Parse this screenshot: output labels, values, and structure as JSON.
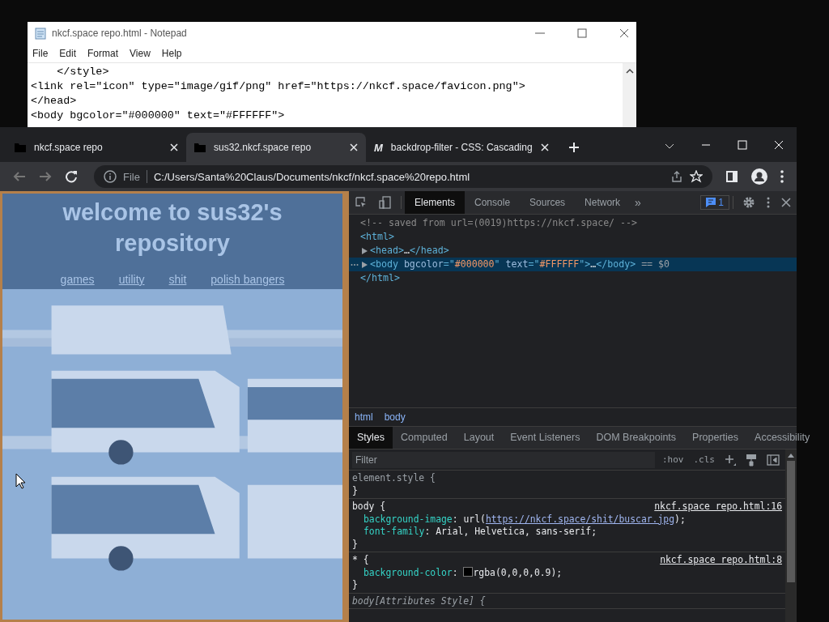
{
  "notepad": {
    "title": "nkcf.space repo.html - Notepad",
    "menu": [
      "File",
      "Edit",
      "Format",
      "View",
      "Help"
    ],
    "lines": [
      "    </style>",
      "<link rel=\"icon\" type=\"image/gif/png\" href=\"https://nkcf.space/favicon.png\">",
      "</head>",
      "<body bgcolor=\"#000000\" text=\"#FFFFFF\">"
    ]
  },
  "browser": {
    "tabs": [
      {
        "title": "nkcf.space repo",
        "selected": false,
        "kind": "page"
      },
      {
        "title": "sus32.nkcf.space repo",
        "selected": true,
        "kind": "page"
      },
      {
        "title": "backdrop-filter - CSS: Cascading",
        "selected": false,
        "kind": "logo",
        "icon_text": "M"
      }
    ],
    "address": {
      "scheme": "File",
      "url": "C:/Users/Santa%20Claus/Documents/nkcf/nkcf.space%20repo.html"
    }
  },
  "page": {
    "heading": "welcome to sus32's repository",
    "links": [
      "games",
      "utility",
      "shit",
      "polish bangers"
    ],
    "background": {
      "kind": "picture"
    }
  },
  "devtools": {
    "tabs": [
      {
        "label": "Elements",
        "selected": true
      },
      {
        "label": "Console",
        "selected": false
      },
      {
        "label": "Sources",
        "selected": false
      },
      {
        "label": "Network",
        "selected": false
      }
    ],
    "more": "»",
    "issues": "1",
    "dom": [
      {
        "segments": [
          {
            "kind": "comment",
            "text": "<!-- saved from url=(0019)https://nkcf.space/ -->"
          }
        ]
      },
      {
        "segments": [
          {
            "kind": "tag",
            "text": "<html>"
          }
        ],
        "closing": [
          {
            "kind": "tag",
            "text": "</html>"
          }
        ],
        "children": [
          {
            "segments": [
              {
                "kind": "tag",
                "text": "<head>"
              },
              {
                "kind": "plain",
                "text": "…"
              },
              {
                "kind": "tag",
                "text": "</head>"
              }
            ],
            "expanded": false,
            "selected": false
          },
          {
            "segments": [
              {
                "kind": "tag",
                "text": "<body"
              },
              {
                "kind": "attr",
                "text": " bgcolor"
              },
              {
                "kind": "tag",
                "text": "=\""
              },
              {
                "kind": "value",
                "text": "#000000"
              },
              {
                "kind": "tag",
                "text": "\""
              },
              {
                "kind": "attr",
                "text": " text"
              },
              {
                "kind": "tag",
                "text": "=\""
              },
              {
                "kind": "value",
                "text": "#FFFFFF"
              },
              {
                "kind": "tag",
                "text": "\">"
              },
              {
                "kind": "plain",
                "text": "…"
              },
              {
                "kind": "tag",
                "text": "</body>"
              },
              {
                "kind": "dim",
                "text": " == $0"
              }
            ],
            "expanded": false,
            "selected": true
          }
        ]
      }
    ],
    "breadcrumbs": [
      "html",
      "body"
    ],
    "panel_tabs": [
      {
        "label": "Styles",
        "selected": true
      },
      {
        "label": "Computed",
        "selected": false
      },
      {
        "label": "Layout",
        "selected": false
      },
      {
        "label": "Event Listeners",
        "selected": false
      },
      {
        "label": "DOM Breakpoints",
        "selected": false
      },
      {
        "label": "Properties",
        "selected": false
      },
      {
        "label": "Accessibility",
        "selected": false
      }
    ],
    "filter": {
      "placeholder": "Filter"
    },
    "filter_buttons": [
      ":hov",
      ".cls"
    ],
    "rules": [
      {
        "kind": "inline",
        "selector": "element.style {",
        "close": "}"
      },
      {
        "kind": "normal",
        "selector": "body {",
        "source": "nkcf.space repo.html:16",
        "declarations": [
          {
            "property": "background-image",
            "value": [
              {
                "kind": "plain",
                "text": ": url("
              },
              {
                "kind": "link",
                "text": "https://nkcf.space/shit/buscar.jpg"
              },
              {
                "kind": "plain",
                "text": ");"
              }
            ]
          },
          {
            "property": "font-family",
            "value": [
              {
                "kind": "plain",
                "text": ": Arial, Helvetica, sans-serif;"
              }
            ]
          }
        ],
        "close": "}"
      },
      {
        "kind": "normal",
        "selector": "* {",
        "source": "nkcf.space repo.html:8",
        "declarations": [
          {
            "property": "background-color",
            "value": [
              {
                "kind": "plain",
                "text": ": "
              },
              {
                "kind": "swatch",
                "color": "#000000"
              },
              {
                "kind": "plain",
                "text": "rgba(0,0,0,0.9);"
              }
            ]
          }
        ],
        "close": "}"
      },
      {
        "kind": "attributes",
        "selector": "body[Attributes Style] {"
      }
    ]
  }
}
